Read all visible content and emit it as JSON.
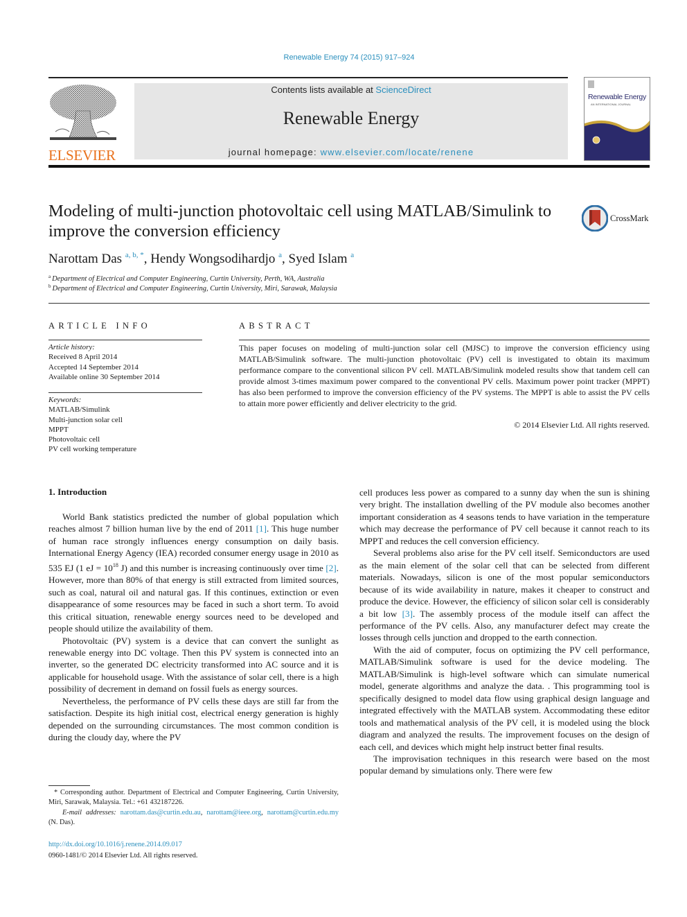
{
  "header": {
    "citation": "Renewable Energy 74 (2015) 917–924",
    "contents_prefix": "Contents lists available at ",
    "contents_link": "ScienceDirect",
    "journal_name": "Renewable Energy",
    "homepage_prefix": "journal homepage: ",
    "homepage_link": "www.elsevier.com/locate/renene",
    "publisher_logo_text": "ELSEVIER",
    "cover_title": "Renewable Energy",
    "cover_subtitle": "AN INTERNATIONAL JOURNAL",
    "colors": {
      "link": "#2a8fbd",
      "elsevier_orange": "#e9711c",
      "masthead_bg": "#e6e6e6",
      "cover_navy": "#2b2a6b",
      "cover_gold": "#c9a43a"
    }
  },
  "article": {
    "title": "Modeling of multi-junction photovoltaic cell using MATLAB/Simulink to improve the conversion efficiency",
    "crossmark_label": "CrossMark",
    "authors": [
      {
        "name": "Narottam Das",
        "marks": "a, b, *"
      },
      {
        "name": "Hendy Wongsodihardjo",
        "marks": "a"
      },
      {
        "name": "Syed Islam",
        "marks": "a"
      }
    ],
    "affiliations": [
      {
        "mark": "a",
        "text": "Department of Electrical and Computer Engineering, Curtin University, Perth, WA, Australia"
      },
      {
        "mark": "b",
        "text": "Department of Electrical and Computer Engineering, Curtin University, Miri, Sarawak, Malaysia"
      }
    ]
  },
  "article_info": {
    "heading": "ARTICLE INFO",
    "history_label": "Article history:",
    "history": [
      "Received 8 April 2014",
      "Accepted 14 September 2014",
      "Available online 30 September 2014"
    ],
    "keywords_label": "Keywords:",
    "keywords": [
      "MATLAB/Simulink",
      "Multi-junction solar cell",
      "MPPT",
      "Photovoltaic cell",
      "PV cell working temperature"
    ]
  },
  "abstract": {
    "heading": "ABSTRACT",
    "text": "This paper focuses on modeling of multi-junction solar cell (MJSC) to improve the conversion efficiency using MATLAB/Simulink software. The multi-junction photovoltaic (PV) cell is investigated to obtain its maximum performance compare to the conventional silicon PV cell. MATLAB/Simulink modeled results show that tandem cell can provide almost 3-times maximum power compared to the conventional PV cells. Maximum power point tracker (MPPT) has also been performed to improve the conversion efficiency of the PV systems. The MPPT is able to assist the PV cells to attain more power efficiently and deliver electricity to the grid.",
    "copyright": "© 2014 Elsevier Ltd. All rights reserved."
  },
  "body": {
    "section_title": "1.  Introduction",
    "p1_a": "World Bank statistics predicted the number of global population which reaches almost 7 billion human live by the end of 2011 ",
    "p1_ref1": "[1]",
    "p1_b": ". This huge number of human race strongly influences energy consumption on daily basis. International Energy Agency (IEA) recorded consumer energy usage in 2010 as 535 EJ (1 eJ = 10",
    "p1_sup": "18",
    "p1_c": " J) and this number is increasing continuously over time ",
    "p1_ref2": "[2]",
    "p1_d": ". However, more than 80% of that energy is still extracted from limited sources, such as coal, natural oil and natural gas. If this continues, extinction or even disappearance of some resources may be faced in such a short term. To avoid this critical situation, renewable energy sources need to be developed and people should utilize the availability of them.",
    "p2": "Photovoltaic (PV) system is a device that can convert the sunlight as renewable energy into DC voltage. Then this PV system is connected into an inverter, so the generated DC electricity transformed into AC source and it is applicable for household usage. With the assistance of solar cell, there is a high possibility of decrement in demand on fossil fuels as energy sources.",
    "p3": "Nevertheless, the performance of PV cells these days are still far from the satisfaction. Despite its high initial cost, electrical energy generation is highly depended on the surrounding circumstances. The most common condition is during the cloudy day, where the PV",
    "r1": "cell produces less power as compared to a sunny day when the sun is shining very bright. The installation dwelling of the PV module also becomes another important consideration as 4 seasons tends to have variation in the temperature which may decrease the performance of PV cell because it cannot reach to its MPPT and reduces the cell conversion efficiency.",
    "r2_a": "Several problems also arise for the PV cell itself. Semiconductors are used as the main element of the solar cell that can be selected from different materials. Nowadays, silicon is one of the most popular semiconductors because of its wide availability in nature, makes it cheaper to construct and produce the device. However, the efficiency of silicon solar cell is considerably a bit low ",
    "r2_ref": "[3]",
    "r2_b": ". The assembly process of the module itself can affect the performance of the PV cells. Also, any manufacturer defect may create the losses through cells junction and dropped to the earth connection.",
    "r3": "With the aid of computer, focus on optimizing the PV cell performance, MATLAB/Simulink software is used for the device modeling. The MATLAB/Simulink is high-level software which can simulate numerical model, generate algorithms and analyze the data. . This programming tool is specifically designed to model data flow using graphical design language and integrated effectively with the MATLAB system. Accommodating these editor tools and mathematical analysis of the PV cell, it is modeled using the block diagram and analyzed the results. The improvement focuses on the design of each cell, and devices which might help instruct better final results.",
    "r4": "The improvisation techniques in this research were based on the most popular demand by simulations only. There were few"
  },
  "footnotes": {
    "corresponding": "* Corresponding author. Department of Electrical and Computer Engineering, Curtin University, Miri, Sarawak, Malaysia. Tel.: +61 432187226.",
    "email_label": "E-mail addresses: ",
    "emails": [
      "narottam.das@curtin.edu.au",
      "narottam@ieee.org",
      "narottam@curtin.edu.my"
    ],
    "email_suffix": " (N. Das).",
    "doi": "http://dx.doi.org/10.1016/j.renene.2014.09.017",
    "issn_copyright": "0960-1481/© 2014 Elsevier Ltd. All rights reserved."
  }
}
